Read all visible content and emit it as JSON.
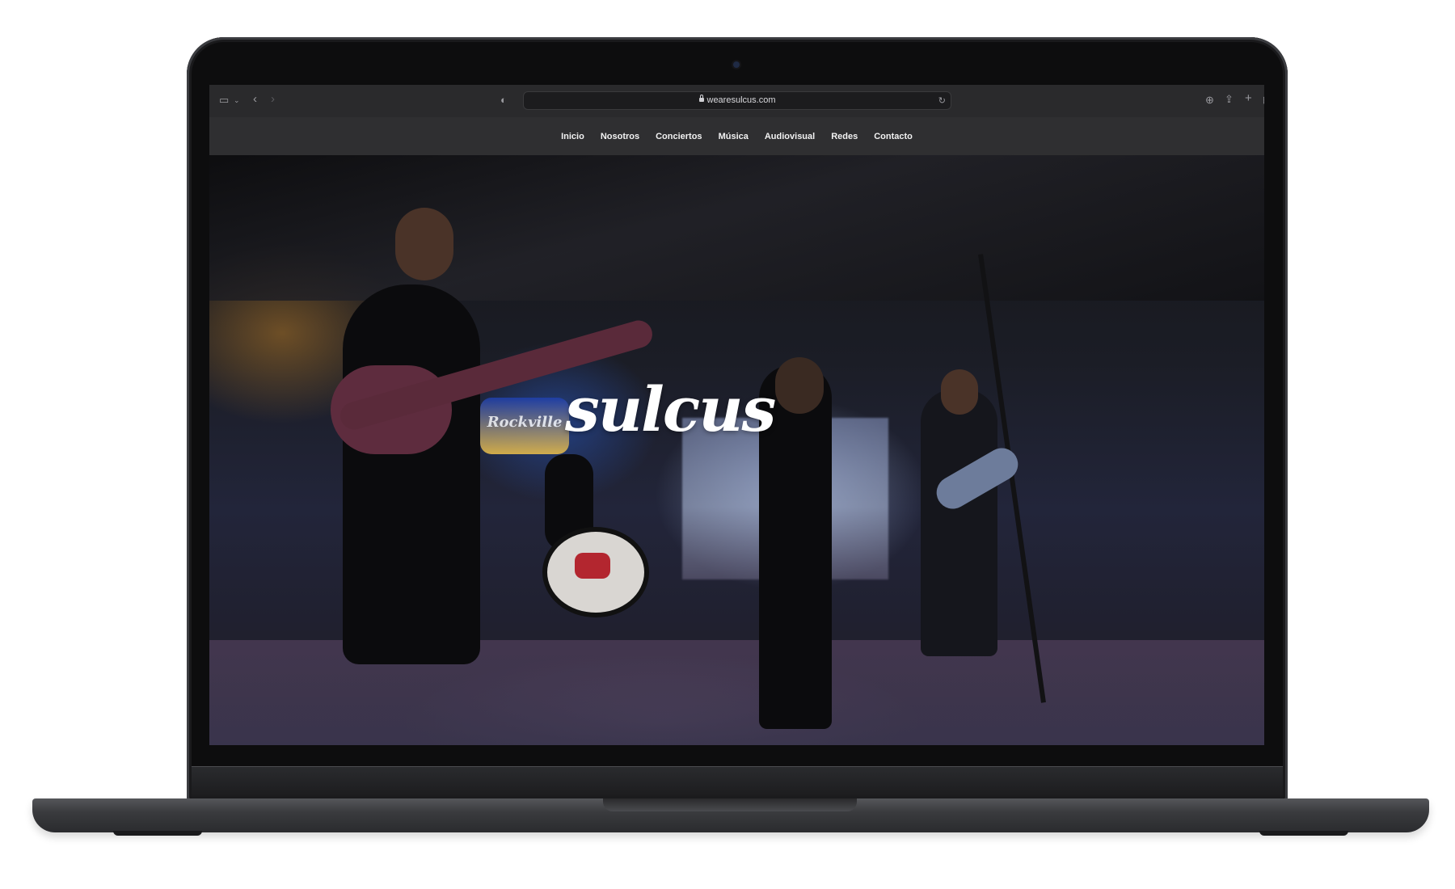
{
  "browser": {
    "url": "wearesulcus.com",
    "icons": {
      "sidebar": "sidebar-icon",
      "chevron": "chevron-down-icon",
      "back": "back-arrow-icon",
      "forward": "forward-arrow-icon",
      "shield": "shield-icon",
      "lock": "lock-icon",
      "reload": "reload-icon",
      "download": "download-icon",
      "share": "share-icon",
      "new_tab": "plus-icon",
      "tabs": "tab-overview-icon"
    }
  },
  "site": {
    "nav": [
      {
        "label": "Inicio"
      },
      {
        "label": "Nosotros"
      },
      {
        "label": "Conciertos"
      },
      {
        "label": "Música"
      },
      {
        "label": "Audiovisual"
      },
      {
        "label": "Redes"
      },
      {
        "label": "Contacto"
      }
    ],
    "hero": {
      "logo_text": "sulcus",
      "sign_text": "Rockville"
    }
  }
}
